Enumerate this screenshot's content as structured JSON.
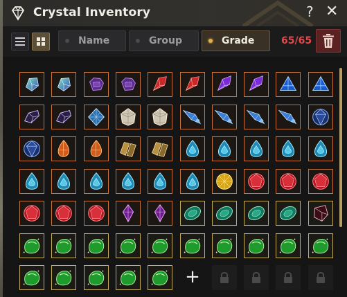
{
  "window": {
    "title": "Crystal Inventory",
    "help_glyph": "?",
    "close_glyph": "✕"
  },
  "toolbar": {
    "tabs": [
      {
        "label": "Name",
        "active": false
      },
      {
        "label": "Group",
        "active": false
      },
      {
        "label": "Grade",
        "active": true
      }
    ],
    "count": "65/65"
  },
  "colors": {
    "accent_gold": "#e0b048",
    "count_red": "#e3494a",
    "trash_bg": "#5a2220",
    "frame_orange": "#c8733a",
    "frame_gold": "#c7ad5a"
  },
  "inventory": {
    "rows": [
      [
        "green-blue-gem",
        "green-blue-gem",
        "purple-hex-gem",
        "purple-hex-gem",
        "red-shard-gem",
        "red-shard-gem",
        "violet-shard-gem",
        "violet-shard-gem",
        "blue-triangle-gem",
        "blue-triangle-gem"
      ],
      [
        "dark-purple-gem",
        "dark-purple-gem",
        "blue-prism-gem",
        "white-prism-gem",
        "white-prism-gem",
        "blue-comet-gem",
        "blue-comet-gem",
        "blue-comet-gem",
        "blue-comet-gem",
        "blue-round-gem"
      ],
      [
        "blue-round-gem",
        "orange-drop-gem",
        "orange-drop-gem",
        "gold-split-gem",
        "gold-split-gem",
        "cyan-drop-gem",
        "cyan-drop-gem",
        "cyan-drop-gem",
        "cyan-drop-gem",
        "cyan-drop-gem"
      ],
      [
        "cyan-drop-gem",
        "cyan-drop-gem",
        "cyan-drop-gem",
        "cyan-drop-gem",
        "cyan-drop-gem",
        "cyan-drop-gem",
        "yellow-round-gem",
        "red-round-gem",
        "red-round-gem",
        "red-round-gem"
      ],
      [
        "red-round-gem",
        "red-round-gem",
        "red-round-gem",
        "magenta-shard-gem",
        "magenta-shard-gem",
        "teal-oval-gem",
        "teal-oval-gem",
        "teal-oval-gem",
        "teal-oval-gem",
        "dark-red-gem"
      ],
      [
        "green-ore-gem",
        "green-ore-gem",
        "green-ore-gem",
        "green-ore-gem",
        "green-ore-gem",
        "green-ore-gem",
        "green-ore-gem",
        "green-ore-gem",
        "green-ore-gem",
        "green-ore-gem"
      ],
      [
        "green-ore-gem",
        "green-ore-gem",
        "green-ore-gem",
        "green-ore-gem",
        "green-ore-gem",
        "add-slot",
        "locked-slot",
        "locked-slot",
        "locked-slot",
        "locked-slot"
      ]
    ],
    "frames": [
      [
        "orange",
        "orange",
        "orange",
        "orange",
        "orange",
        "orange",
        "orange",
        "orange",
        "orange",
        "orange"
      ],
      [
        "orange",
        "orange",
        "orange",
        "orange",
        "orange",
        "orange",
        "orange",
        "orange",
        "orange",
        "orange"
      ],
      [
        "orange",
        "orange",
        "orange",
        "orange",
        "orange",
        "orange",
        "orange",
        "orange",
        "orange",
        "orange"
      ],
      [
        "orange",
        "orange",
        "orange",
        "orange",
        "orange",
        "orange",
        "orange",
        "orange",
        "orange",
        "orange"
      ],
      [
        "orange",
        "orange",
        "orange",
        "orange",
        "orange",
        "gold",
        "gold",
        "gold",
        "gold",
        "gold"
      ],
      [
        "gold",
        "gold",
        "gold",
        "gold",
        "gold",
        "gold",
        "gold",
        "gold",
        "gold",
        "gold"
      ],
      [
        "gold",
        "gold",
        "gold",
        "gold",
        "gold",
        "add",
        "locked",
        "locked",
        "locked",
        "locked"
      ]
    ],
    "add_glyph": "+"
  }
}
